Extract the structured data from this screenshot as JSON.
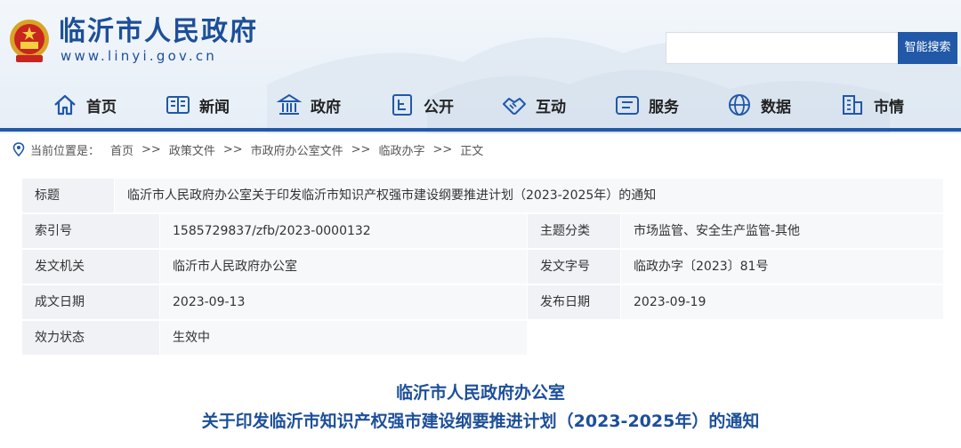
{
  "header": {
    "site_title": "临沂市人民政府",
    "site_url": "www.linyi.gov.cn",
    "search_placeholder": "",
    "search_button": "智能搜索"
  },
  "nav": {
    "items": [
      {
        "label": "首页",
        "icon": "home-icon"
      },
      {
        "label": "新闻",
        "icon": "news-icon"
      },
      {
        "label": "政府",
        "icon": "government-building-icon"
      },
      {
        "label": "公开",
        "icon": "open-document-icon"
      },
      {
        "label": "互动",
        "icon": "handshake-icon"
      },
      {
        "label": "服务",
        "icon": "service-icon"
      },
      {
        "label": "数据",
        "icon": "data-globe-icon"
      },
      {
        "label": "市情",
        "icon": "city-building-icon"
      }
    ]
  },
  "breadcrumb": {
    "prefix": "当前位置是：",
    "items": [
      "首页",
      "政策文件",
      "市政府办公室文件",
      "临政办字",
      "正文"
    ],
    "separator": ">>"
  },
  "meta": {
    "title_label": "标题",
    "title_value": "临沂市人民政府办公室关于印发临沂市知识产权强市建设纲要推进计划（2023-2025年）的通知",
    "index_label": "索引号",
    "index_value": "1585729837/zfb/2023-0000132",
    "topic_label": "主题分类",
    "topic_value": "市场监管、安全生产监管-其他",
    "issuer_label": "发文机关",
    "issuer_value": "临沂市人民政府办公室",
    "docno_label": "发文字号",
    "docno_value": "临政办字〔2023〕81号",
    "created_label": "成文日期",
    "created_value": "2023-09-13",
    "published_label": "发布日期",
    "published_value": "2023-09-19",
    "status_label": "效力状态",
    "status_value": "生效中"
  },
  "document": {
    "title_line1": "临沂市人民政府办公室",
    "title_line2": "关于印发临沂市知识产权强市建设纲要推进计划（2023-2025年）的通知"
  },
  "colors": {
    "brand_blue": "#1d4f99",
    "nav_line": "#2158a8",
    "label_bg": "#f0f2f6",
    "value_bg": "#f7f8fa"
  }
}
